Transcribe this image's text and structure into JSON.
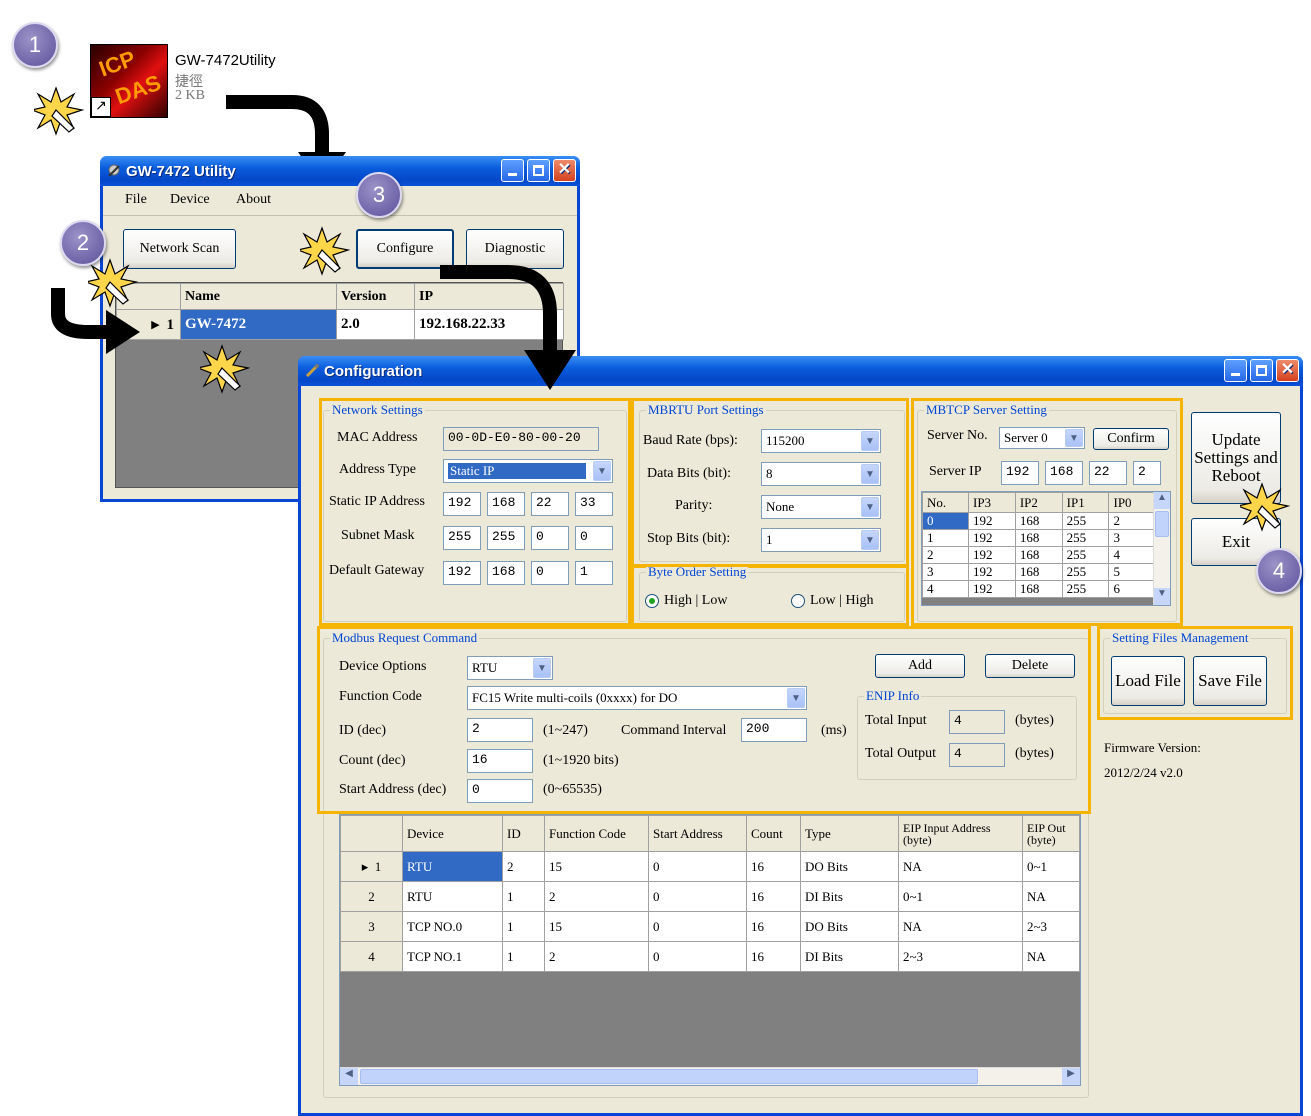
{
  "steps": [
    "1",
    "2",
    "3",
    "4"
  ],
  "shortcut": {
    "name": "GW-7472Utility",
    "type": "捷徑",
    "size": "2 KB"
  },
  "utility": {
    "title": "GW-7472 Utility",
    "menu": [
      "File",
      "Device",
      "About"
    ],
    "buttons": {
      "scan": "Network Scan",
      "configure": "Configure",
      "diagnostic": "Diagnostic"
    },
    "columns": [
      "Name",
      "Version",
      "IP"
    ],
    "row": {
      "num": "1",
      "name": "GW-7472",
      "version": "2.0",
      "ip": "192.168.22.33"
    }
  },
  "config": {
    "title": "Configuration",
    "network": {
      "title": "Network Settings",
      "mac_label": "MAC Address",
      "mac": "00-0D-E0-80-00-20",
      "addr_type_label": "Address Type",
      "addr_type": "Static IP",
      "static_ip_label": "Static IP Address",
      "static_ip": [
        "192",
        "168",
        "22",
        "33"
      ],
      "mask_label": "Subnet Mask",
      "mask": [
        "255",
        "255",
        "0",
        "0"
      ],
      "gateway_label": "Default Gateway",
      "gateway": [
        "192",
        "168",
        "0",
        "1"
      ]
    },
    "rtu": {
      "title": "MBRTU Port Settings",
      "baud_label": "Baud Rate (bps):",
      "baud": "115200",
      "databits_label": "Data Bits (bit):",
      "databits": "8",
      "parity_label": "Parity:",
      "parity": "None",
      "stopbits_label": "Stop Bits (bit):",
      "stopbits": "1"
    },
    "byte_order": {
      "title": "Byte Order Setting",
      "opt1": "High | Low",
      "opt2": "Low | High",
      "selected": "High | Low"
    },
    "tcp": {
      "title": "MBTCP Server Setting",
      "server_no_label": "Server No.",
      "server_no": "Server 0",
      "confirm": "Confirm",
      "server_ip_label": "Server IP",
      "server_ip": [
        "192",
        "168",
        "22",
        "2"
      ],
      "columns": [
        "No.",
        "IP3",
        "IP2",
        "IP1",
        "IP0"
      ],
      "rows": [
        [
          "0",
          "192",
          "168",
          "255",
          "2"
        ],
        [
          "1",
          "192",
          "168",
          "255",
          "3"
        ],
        [
          "2",
          "192",
          "168",
          "255",
          "4"
        ],
        [
          "3",
          "192",
          "168",
          "255",
          "5"
        ],
        [
          "4",
          "192",
          "168",
          "255",
          "6"
        ]
      ]
    },
    "side": {
      "update": "Update Settings and Reboot",
      "exit": "Exit"
    },
    "files": {
      "title": "Setting Files Management",
      "load": "Load File",
      "save": "Save File"
    },
    "firmware": {
      "label": "Firmware Version:",
      "value": "2012/2/24 v2.0"
    },
    "modbus": {
      "title": "Modbus Request Command",
      "device_label": "Device Options",
      "device": "RTU",
      "fc_label": "Function Code",
      "fc": "FC15  Write multi-coils (0xxxx) for DO",
      "id_label": "ID (dec)",
      "id": "2",
      "id_range": "(1~247)",
      "interval_label": "Command Interval",
      "interval": "200",
      "interval_unit": "(ms)",
      "count_label": "Count (dec)",
      "count": "16",
      "count_range": "(1~1920 bits)",
      "start_label": "Start Address (dec)",
      "start": "0",
      "start_range": "(0~65535)",
      "add": "Add",
      "delete": "Delete"
    },
    "enip": {
      "title": "ENIP Info",
      "input_label": "Total Input",
      "input": "4",
      "output_label": "Total Output",
      "output": "4",
      "unit": "(bytes)"
    },
    "table": {
      "columns": [
        "Device",
        "ID",
        "Function Code",
        "Start Address",
        "Count",
        "Type",
        "EIP Input Address (byte)",
        "EIP Out (byte)"
      ],
      "rows": [
        [
          "1",
          "RTU",
          "2",
          "15",
          "0",
          "16",
          "DO Bits",
          "NA",
          "0~1"
        ],
        [
          "2",
          "RTU",
          "1",
          "2",
          "0",
          "16",
          "DI Bits",
          "0~1",
          "NA"
        ],
        [
          "3",
          "TCP NO.0",
          "1",
          "15",
          "0",
          "16",
          "DO Bits",
          "NA",
          "2~3"
        ],
        [
          "4",
          "TCP NO.1",
          "1",
          "2",
          "0",
          "16",
          "DI Bits",
          "2~3",
          "NA"
        ]
      ]
    }
  }
}
